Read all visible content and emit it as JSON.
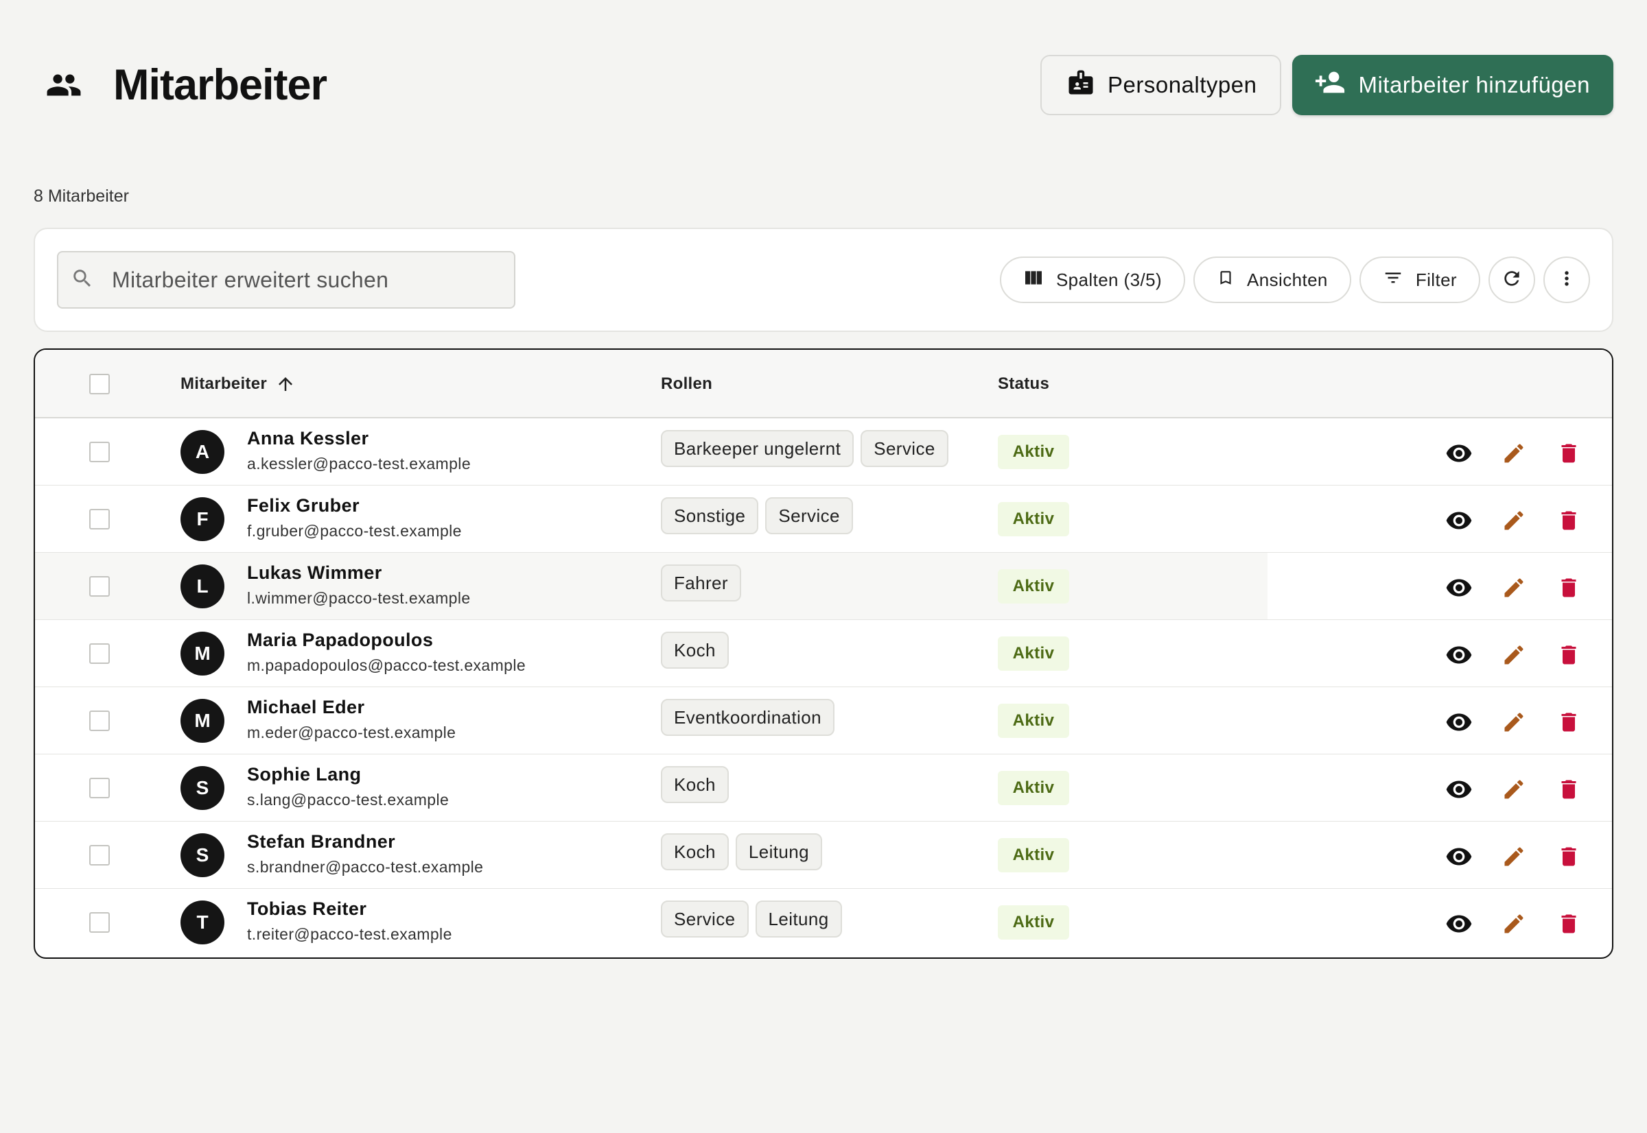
{
  "header": {
    "title": "Mitarbeiter",
    "personaltypen_label": "Personaltypen",
    "add_label": "Mitarbeiter hinzufügen"
  },
  "count_label": "8 Mitarbeiter",
  "toolbar": {
    "search_placeholder": "Mitarbeiter erweitert suchen",
    "columns_label": "Spalten (3/5)",
    "views_label": "Ansichten",
    "filter_label": "Filter"
  },
  "table": {
    "columns": [
      "Mitarbeiter",
      "Rollen",
      "Status"
    ],
    "sort": "ascending",
    "rows": [
      {
        "initial": "A",
        "name": "Anna Kessler",
        "email": "a.kessler@pacco-test.example",
        "roles": [
          "Barkeeper ungelernt",
          "Service"
        ],
        "status": "Aktiv"
      },
      {
        "initial": "F",
        "name": "Felix Gruber",
        "email": "f.gruber@pacco-test.example",
        "roles": [
          "Sonstige",
          "Service"
        ],
        "status": "Aktiv"
      },
      {
        "initial": "L",
        "name": "Lukas Wimmer",
        "email": "l.wimmer@pacco-test.example",
        "roles": [
          "Fahrer"
        ],
        "status": "Aktiv"
      },
      {
        "initial": "M",
        "name": "Maria Papadopoulos",
        "email": "m.papadopoulos@pacco-test.example",
        "roles": [
          "Koch"
        ],
        "status": "Aktiv"
      },
      {
        "initial": "M",
        "name": "Michael Eder",
        "email": "m.eder@pacco-test.example",
        "roles": [
          "Eventkoordination"
        ],
        "status": "Aktiv"
      },
      {
        "initial": "S",
        "name": "Sophie Lang",
        "email": "s.lang@pacco-test.example",
        "roles": [
          "Koch"
        ],
        "status": "Aktiv"
      },
      {
        "initial": "S",
        "name": "Stefan Brandner",
        "email": "s.brandner@pacco-test.example",
        "roles": [
          "Koch",
          "Leitung"
        ],
        "status": "Aktiv"
      },
      {
        "initial": "T",
        "name": "Tobias Reiter",
        "email": "t.reiter@pacco-test.example",
        "roles": [
          "Service",
          "Leitung"
        ],
        "status": "Aktiv"
      }
    ]
  },
  "colors": {
    "primary": "#2f6f55",
    "edit": "#a9591c",
    "delete": "#c8103c",
    "status_text": "#4c6a14",
    "status_bg": "#f1f9e4"
  },
  "icons": [
    "people-icon",
    "badge-icon",
    "person-add-icon",
    "search-icon",
    "columns-icon",
    "bookmark-icon",
    "filter-icon",
    "refresh-icon",
    "more-vert-icon",
    "arrow-up-icon",
    "eye-icon",
    "pencil-icon",
    "trash-icon"
  ]
}
